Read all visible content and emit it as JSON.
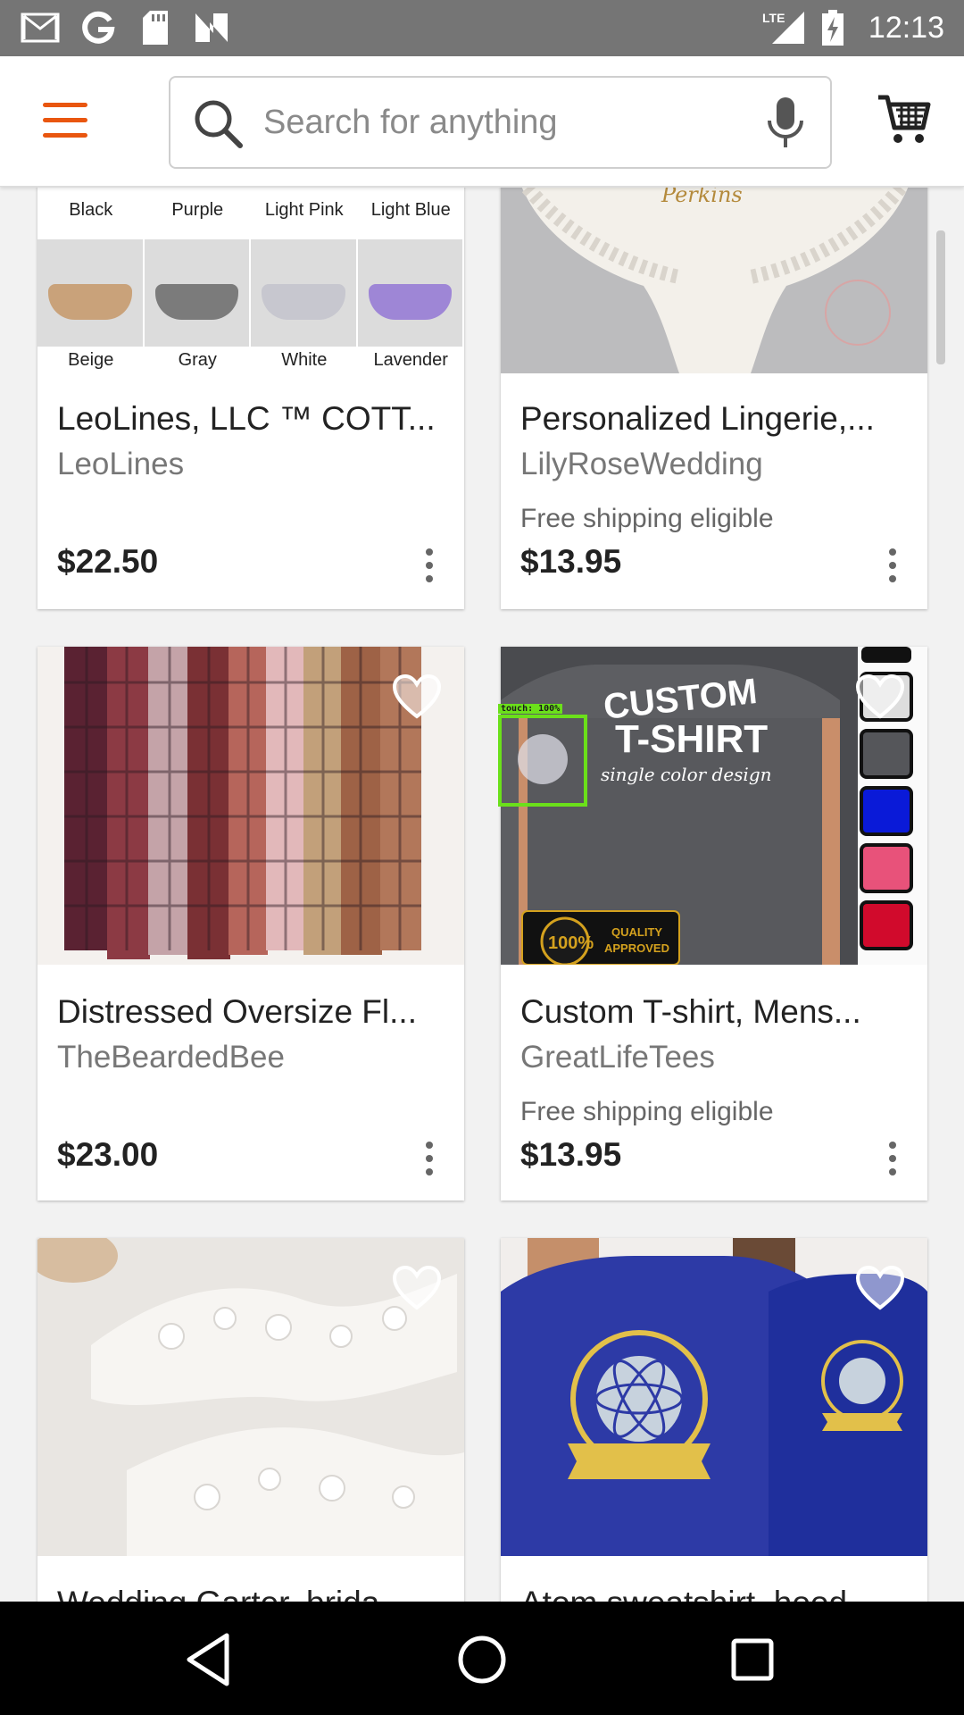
{
  "status_bar": {
    "time": "12:13",
    "network": "LTE",
    "icons": [
      "gmail-icon",
      "google-icon",
      "sd-card-icon",
      "n-icon",
      "signal-icon",
      "battery-charging-icon"
    ]
  },
  "app_bar": {
    "menu_icon": "hamburger-menu-icon",
    "search_placeholder": "Search for anything",
    "search_value": "",
    "mic_icon": "microphone-icon",
    "cart_icon": "shopping-cart-icon",
    "accent_color": "#e9560f"
  },
  "listings": [
    {
      "title": "LeoLines, LLC ™ COTT...",
      "shop": "LeoLines",
      "shipping": "",
      "price": "$22.50",
      "image_labels_top": [
        "Black",
        "Purple",
        "Light Pink",
        "Light Blue"
      ],
      "image_labels_bottom": [
        "Beige",
        "Gray",
        "White",
        "Lavender"
      ]
    },
    {
      "title": "Personalized Lingerie,...",
      "shop": "LilyRoseWedding",
      "shipping": "Free shipping eligible",
      "price": "$13.95",
      "image_text": "Perkins"
    },
    {
      "title": "Distressed Oversize Fl...",
      "shop": "TheBeardedBee",
      "shipping": "",
      "price": "$23.00"
    },
    {
      "title": "Custom T-shirt, Mens...",
      "shop": "GreatLifeTees",
      "shipping": "Free shipping eligible",
      "price": "$13.95",
      "image_text": {
        "line1": "CUSTOM",
        "line2": "T-SHIRT",
        "line3": "single color design",
        "badge_top": "QUALITY",
        "badge_bottom": "APPROVED",
        "badge_seal": "100%"
      }
    },
    {
      "title": "Wedding Garter, brida..."
    },
    {
      "title": "Atom sweatshirt, hood..."
    }
  ],
  "overlay": {
    "touch_label": "touch: 100%"
  },
  "nav_bar": {
    "back_icon": "back-triangle-icon",
    "home_icon": "home-circle-icon",
    "recents_icon": "recents-square-icon"
  }
}
